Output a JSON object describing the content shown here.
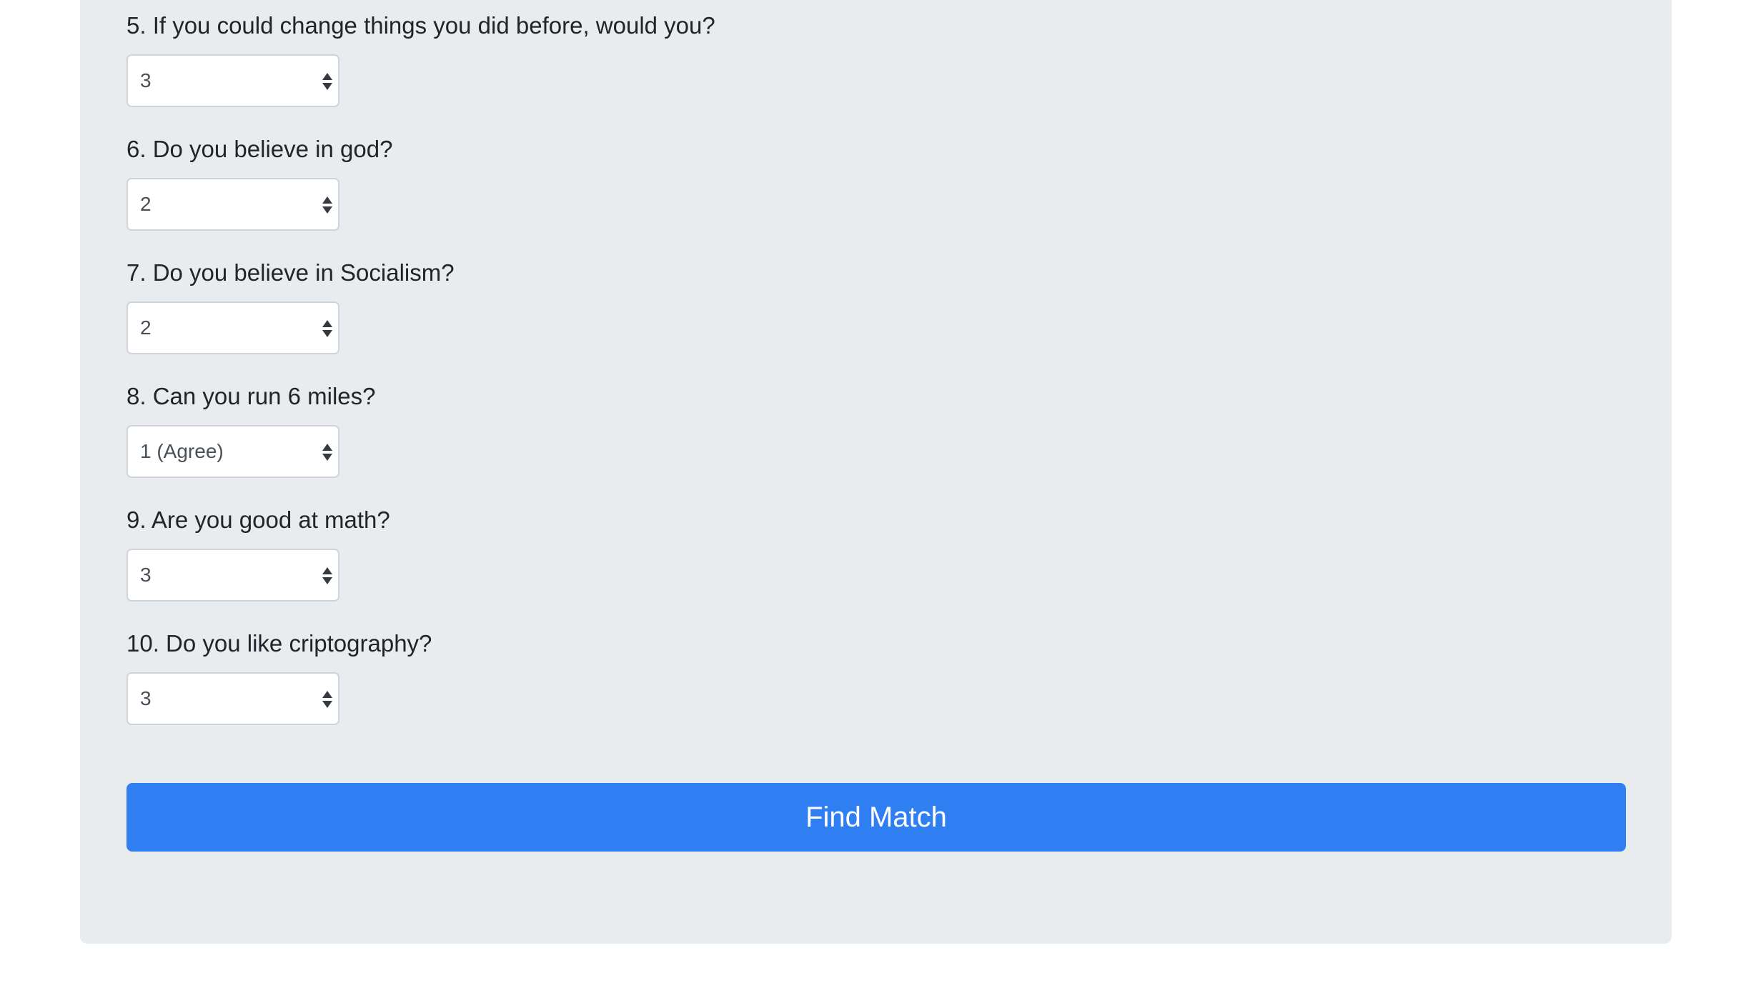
{
  "questions": [
    {
      "label": "5. If you could change things you did before, would you?",
      "value": "3"
    },
    {
      "label": "6. Do you believe in god?",
      "value": "2"
    },
    {
      "label": "7. Do you believe in Socialism?",
      "value": "2"
    },
    {
      "label": "8. Can you run 6 miles?",
      "value": "1 (Agree)"
    },
    {
      "label": "9. Are you good at math?",
      "value": "3"
    },
    {
      "label": "10. Do you like criptography?",
      "value": "3"
    }
  ],
  "submit": {
    "label": "Find Match"
  },
  "colors": {
    "panel_bg": "#e9ecef",
    "button_bg": "#2f7ff2",
    "text": "#212529"
  }
}
